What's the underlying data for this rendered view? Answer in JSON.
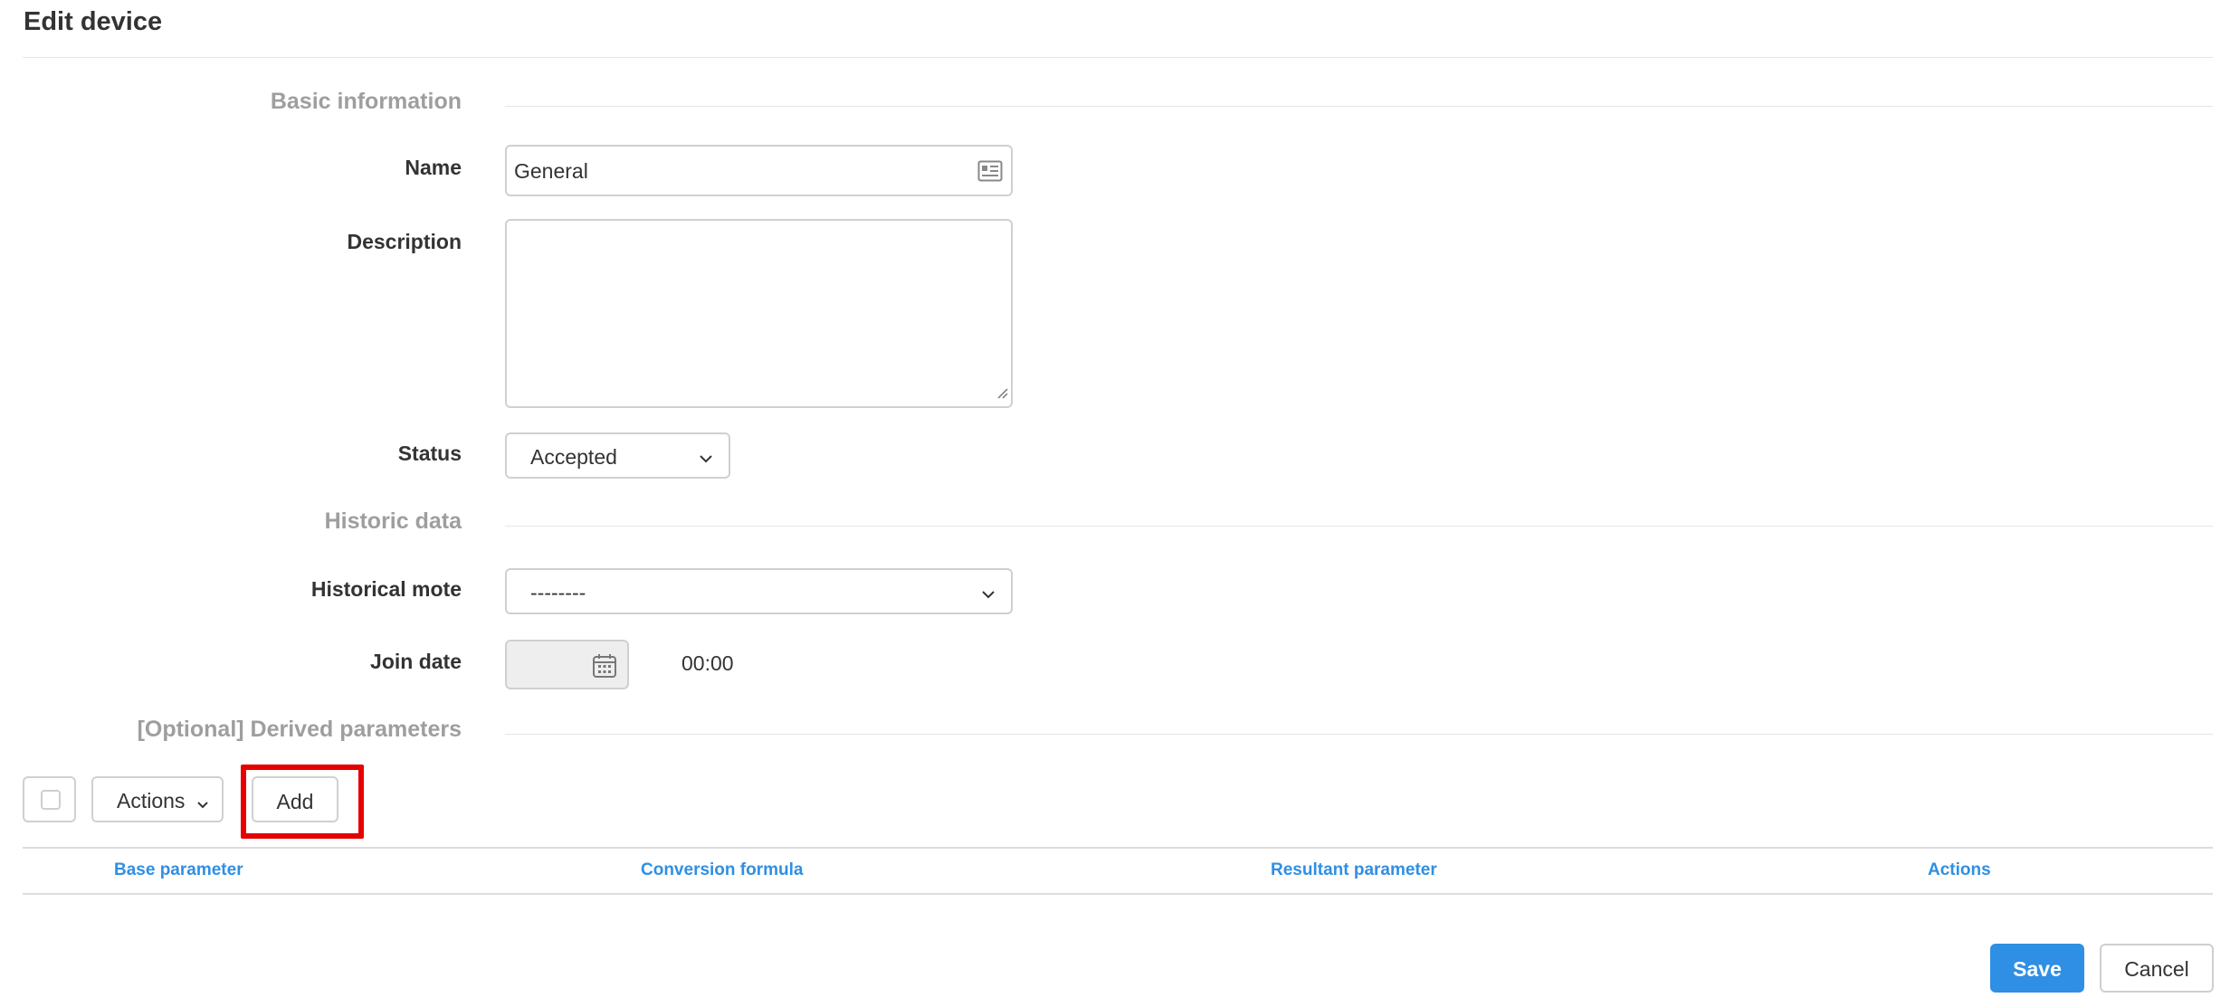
{
  "page": {
    "title": "Edit device"
  },
  "sections": {
    "basic": "Basic information",
    "historic": "Historic data",
    "derived": "[Optional] Derived parameters"
  },
  "fields": {
    "name": {
      "label": "Name",
      "value": "General"
    },
    "description": {
      "label": "Description",
      "value": ""
    },
    "status": {
      "label": "Status",
      "value": "Accepted"
    },
    "historical_mote": {
      "label": "Historical mote",
      "value": "--------"
    },
    "join_date": {
      "label": "Join date",
      "time": "00:00"
    }
  },
  "toolbar": {
    "actions_label": "Actions",
    "add_label": "Add"
  },
  "table": {
    "columns": [
      "Base parameter",
      "Conversion formula",
      "Resultant parameter",
      "Actions"
    ]
  },
  "footer": {
    "save_label": "Save",
    "cancel_label": "Cancel"
  },
  "colors": {
    "accent": "#2f8fe4",
    "highlight": "#e60000"
  },
  "icons": {
    "name_field": "id-card-icon",
    "date_field": "calendar-icon",
    "select": "chevron-down-icon"
  }
}
